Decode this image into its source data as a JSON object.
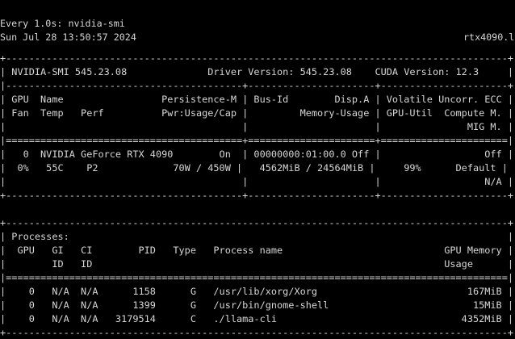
{
  "terminal": {
    "watch_header": "Every 1.0s: nvidia-smi",
    "hostname": "rtx4090.l",
    "timestamp": "Sun Jul 28 13:50:57 2024",
    "colors": {
      "background": "#000000",
      "text": "#d6d6d6"
    }
  },
  "smi_lines": [
    "+---------------------------------------------------------------------------------------+",
    "| NVIDIA-SMI 545.23.08              Driver Version: 545.23.08    CUDA Version: 12.3     |",
    "|-----------------------------------------+----------------------+----------------------+",
    "| GPU  Name                 Persistence-M | Bus-Id        Disp.A | Volatile Uncorr. ECC |",
    "| Fan  Temp   Perf          Pwr:Usage/Cap |         Memory-Usage | GPU-Util  Compute M. |",
    "|                                         |                      |               MIG M. |",
    "|=========================================+======================+======================|",
    "|   0  NVIDIA GeForce RTX 4090        On  | 00000000:01:00.0 Off |                  Off |",
    "|  0%   55C    P2             70W / 450W |   4562MiB / 24564MiB |     99%      Default |",
    "|                                         |                      |                  N/A |",
    "+-----------------------------------------+----------------------+----------------------+",
    "+---------------------------------------------------------------------------------------+",
    "| Processes:                                                                            |",
    "|  GPU   GI   CI        PID   Type   Process name                            GPU Memory |",
    "|        ID   ID                                                             Usage      |",
    "|=======================================================================================|",
    "|    0   N/A  N/A      1158      G   /usr/lib/xorg/Xorg                          167MiB |",
    "|    0   N/A  N/A      1399      G   /usr/bin/gnome-shell                         15MiB |",
    "|    0   N/A  N/A   3179514      C   ./llama-cli                                4352MiB |",
    "+---------------------------------------------------------------------------------------+"
  ]
}
